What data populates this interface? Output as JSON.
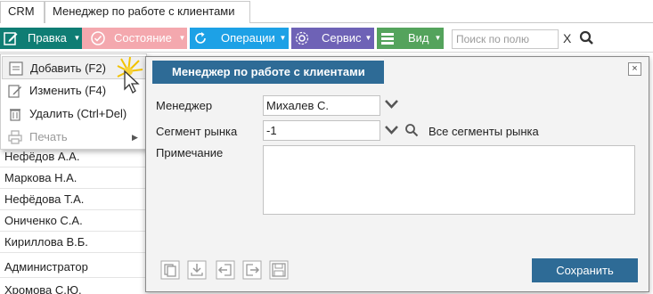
{
  "tabs": [
    {
      "label": "CRM"
    },
    {
      "label": "Менеджер по работе с клиентами",
      "close": "×"
    }
  ],
  "toolbar": {
    "edit_label": "Правка",
    "state_label": "Состояние",
    "operations_label": "Операции",
    "service_label": "Сервис",
    "view_label": "Вид",
    "search_placeholder": "Поиск по полю",
    "clear": "X"
  },
  "colors": {
    "edit": "#0f7d74",
    "state": "#f4a8ae",
    "operations": "#1da1e6",
    "service": "#6e62b6",
    "view": "#54a35c",
    "accent": "#2e6b96"
  },
  "list": [
    "Нефёдов А.А.",
    "Маркова Н.А.",
    "Нефёдова Т.А.",
    "Ониченко С.А.",
    "Кириллова В.Б.",
    "Администратор",
    "Хромова С.Ю."
  ],
  "menu": [
    {
      "label": "Добавить (F2)",
      "icon": "add-doc-icon"
    },
    {
      "label": "Изменить (F4)",
      "icon": "pencil-icon"
    },
    {
      "label": "Удалить (Ctrl+Del)",
      "icon": "trash-icon"
    },
    {
      "label": "Печать",
      "icon": "printer-icon",
      "submenu": "▶"
    }
  ],
  "dialog": {
    "title": "Менеджер по работе с клиентами",
    "close": "×",
    "manager_label": "Менеджер",
    "manager_value": "Михалев С.",
    "segment_label": "Сегмент рынка",
    "segment_value": "-1",
    "segment_text": "Все сегменты рынка",
    "note_label": "Примечание",
    "note_value": "",
    "save_label": "Сохранить"
  }
}
